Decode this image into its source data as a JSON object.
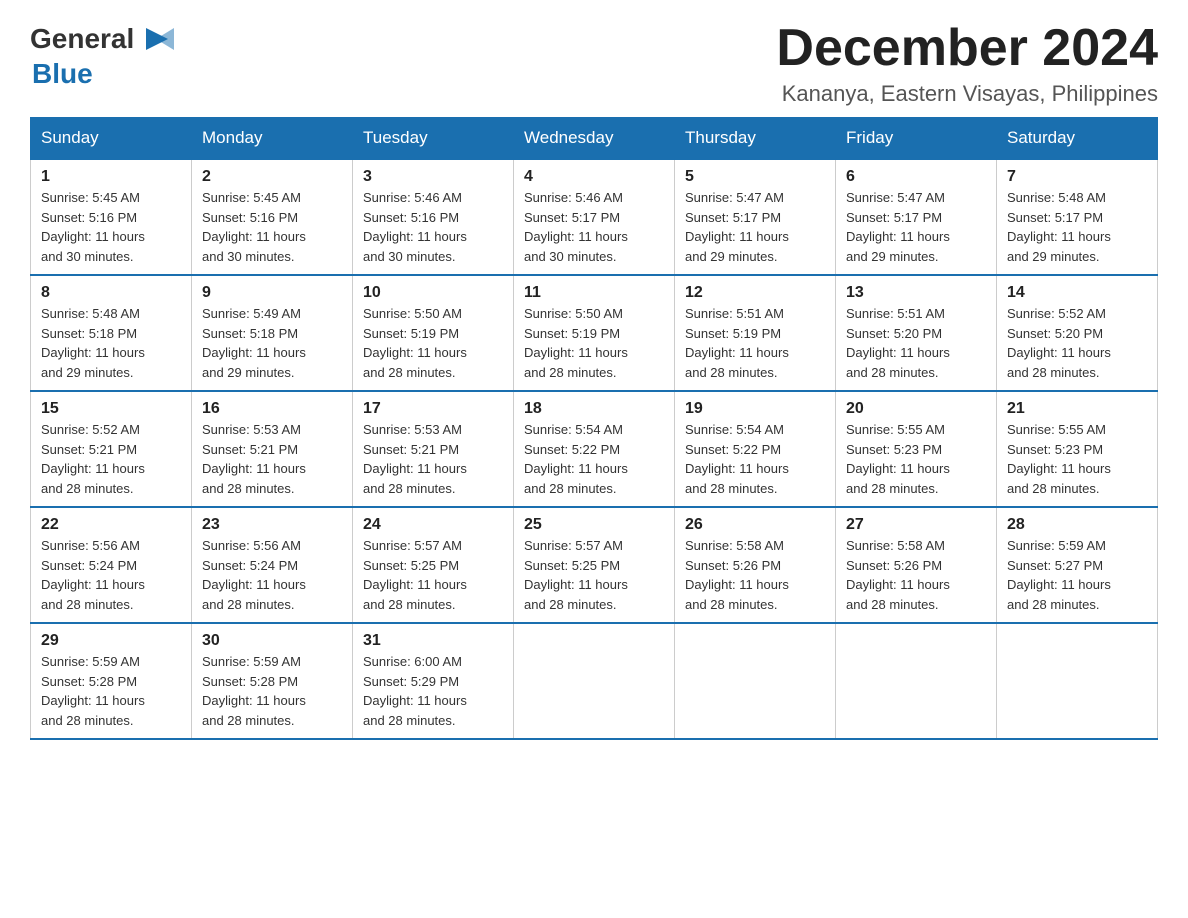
{
  "logo": {
    "text_general": "General",
    "text_blue": "Blue",
    "icon_symbol": "▶"
  },
  "header": {
    "month_title": "December 2024",
    "location": "Kananya, Eastern Visayas, Philippines"
  },
  "days_of_week": [
    "Sunday",
    "Monday",
    "Tuesday",
    "Wednesday",
    "Thursday",
    "Friday",
    "Saturday"
  ],
  "weeks": [
    [
      {
        "day": "1",
        "sunrise": "5:45 AM",
        "sunset": "5:16 PM",
        "daylight": "11 hours and 30 minutes."
      },
      {
        "day": "2",
        "sunrise": "5:45 AM",
        "sunset": "5:16 PM",
        "daylight": "11 hours and 30 minutes."
      },
      {
        "day": "3",
        "sunrise": "5:46 AM",
        "sunset": "5:16 PM",
        "daylight": "11 hours and 30 minutes."
      },
      {
        "day": "4",
        "sunrise": "5:46 AM",
        "sunset": "5:17 PM",
        "daylight": "11 hours and 30 minutes."
      },
      {
        "day": "5",
        "sunrise": "5:47 AM",
        "sunset": "5:17 PM",
        "daylight": "11 hours and 29 minutes."
      },
      {
        "day": "6",
        "sunrise": "5:47 AM",
        "sunset": "5:17 PM",
        "daylight": "11 hours and 29 minutes."
      },
      {
        "day": "7",
        "sunrise": "5:48 AM",
        "sunset": "5:17 PM",
        "daylight": "11 hours and 29 minutes."
      }
    ],
    [
      {
        "day": "8",
        "sunrise": "5:48 AM",
        "sunset": "5:18 PM",
        "daylight": "11 hours and 29 minutes."
      },
      {
        "day": "9",
        "sunrise": "5:49 AM",
        "sunset": "5:18 PM",
        "daylight": "11 hours and 29 minutes."
      },
      {
        "day": "10",
        "sunrise": "5:50 AM",
        "sunset": "5:19 PM",
        "daylight": "11 hours and 28 minutes."
      },
      {
        "day": "11",
        "sunrise": "5:50 AM",
        "sunset": "5:19 PM",
        "daylight": "11 hours and 28 minutes."
      },
      {
        "day": "12",
        "sunrise": "5:51 AM",
        "sunset": "5:19 PM",
        "daylight": "11 hours and 28 minutes."
      },
      {
        "day": "13",
        "sunrise": "5:51 AM",
        "sunset": "5:20 PM",
        "daylight": "11 hours and 28 minutes."
      },
      {
        "day": "14",
        "sunrise": "5:52 AM",
        "sunset": "5:20 PM",
        "daylight": "11 hours and 28 minutes."
      }
    ],
    [
      {
        "day": "15",
        "sunrise": "5:52 AM",
        "sunset": "5:21 PM",
        "daylight": "11 hours and 28 minutes."
      },
      {
        "day": "16",
        "sunrise": "5:53 AM",
        "sunset": "5:21 PM",
        "daylight": "11 hours and 28 minutes."
      },
      {
        "day": "17",
        "sunrise": "5:53 AM",
        "sunset": "5:21 PM",
        "daylight": "11 hours and 28 minutes."
      },
      {
        "day": "18",
        "sunrise": "5:54 AM",
        "sunset": "5:22 PM",
        "daylight": "11 hours and 28 minutes."
      },
      {
        "day": "19",
        "sunrise": "5:54 AM",
        "sunset": "5:22 PM",
        "daylight": "11 hours and 28 minutes."
      },
      {
        "day": "20",
        "sunrise": "5:55 AM",
        "sunset": "5:23 PM",
        "daylight": "11 hours and 28 minutes."
      },
      {
        "day": "21",
        "sunrise": "5:55 AM",
        "sunset": "5:23 PM",
        "daylight": "11 hours and 28 minutes."
      }
    ],
    [
      {
        "day": "22",
        "sunrise": "5:56 AM",
        "sunset": "5:24 PM",
        "daylight": "11 hours and 28 minutes."
      },
      {
        "day": "23",
        "sunrise": "5:56 AM",
        "sunset": "5:24 PM",
        "daylight": "11 hours and 28 minutes."
      },
      {
        "day": "24",
        "sunrise": "5:57 AM",
        "sunset": "5:25 PM",
        "daylight": "11 hours and 28 minutes."
      },
      {
        "day": "25",
        "sunrise": "5:57 AM",
        "sunset": "5:25 PM",
        "daylight": "11 hours and 28 minutes."
      },
      {
        "day": "26",
        "sunrise": "5:58 AM",
        "sunset": "5:26 PM",
        "daylight": "11 hours and 28 minutes."
      },
      {
        "day": "27",
        "sunrise": "5:58 AM",
        "sunset": "5:26 PM",
        "daylight": "11 hours and 28 minutes."
      },
      {
        "day": "28",
        "sunrise": "5:59 AM",
        "sunset": "5:27 PM",
        "daylight": "11 hours and 28 minutes."
      }
    ],
    [
      {
        "day": "29",
        "sunrise": "5:59 AM",
        "sunset": "5:28 PM",
        "daylight": "11 hours and 28 minutes."
      },
      {
        "day": "30",
        "sunrise": "5:59 AM",
        "sunset": "5:28 PM",
        "daylight": "11 hours and 28 minutes."
      },
      {
        "day": "31",
        "sunrise": "6:00 AM",
        "sunset": "5:29 PM",
        "daylight": "11 hours and 28 minutes."
      },
      null,
      null,
      null,
      null
    ]
  ],
  "labels": {
    "sunrise": "Sunrise:",
    "sunset": "Sunset:",
    "daylight": "Daylight:"
  }
}
